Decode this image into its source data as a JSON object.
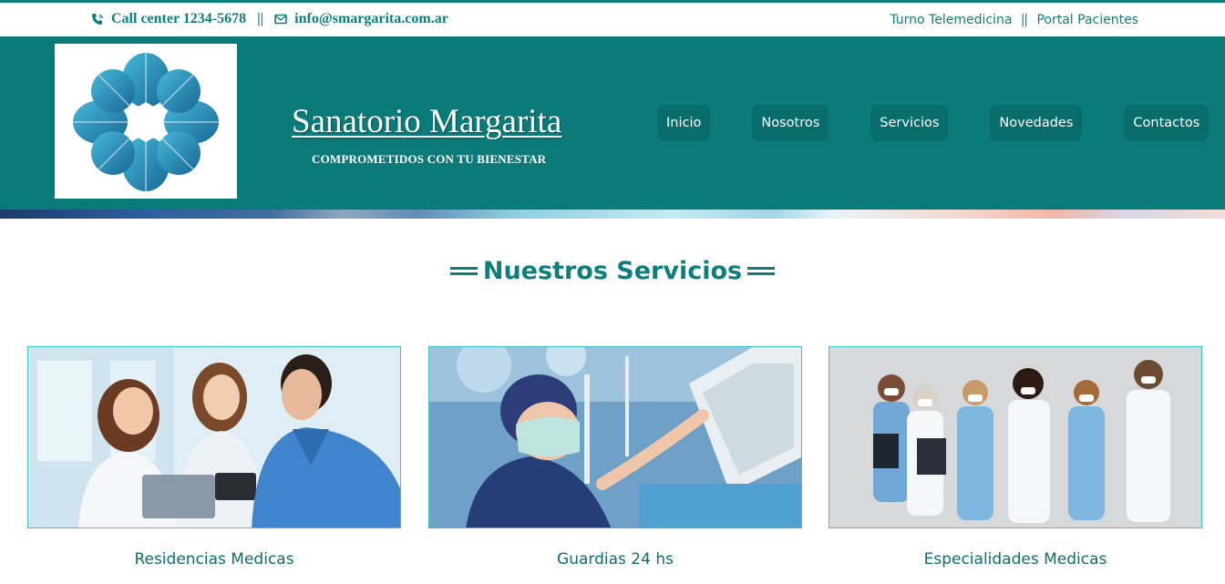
{
  "topbar": {
    "phone_label": "Call center 1234-5678",
    "separator": "||",
    "email_label": "info@smargarita.com.ar",
    "links": [
      "Turno Telemedicina",
      "Portal Pacientes"
    ],
    "icons": [
      "phone-icon",
      "envelope-icon"
    ]
  },
  "header": {
    "site_name": "Sanatorio Margarita",
    "tagline": "COMPROMETIDOS CON TU BIENESTAR",
    "nav": [
      "Inicio",
      "Nosotros",
      "Servicios",
      "Novedades",
      "Contactos"
    ]
  },
  "services": {
    "title": "Nuestros Servicios",
    "cards": [
      {
        "label": "Residencias Medicas"
      },
      {
        "label": "Guardias 24 hs"
      },
      {
        "label": "Especialidades Medicas"
      }
    ]
  },
  "colors": {
    "brand": "#0a7b79",
    "nav_item": "#076c6a",
    "card_border": "#3cc3c6"
  }
}
